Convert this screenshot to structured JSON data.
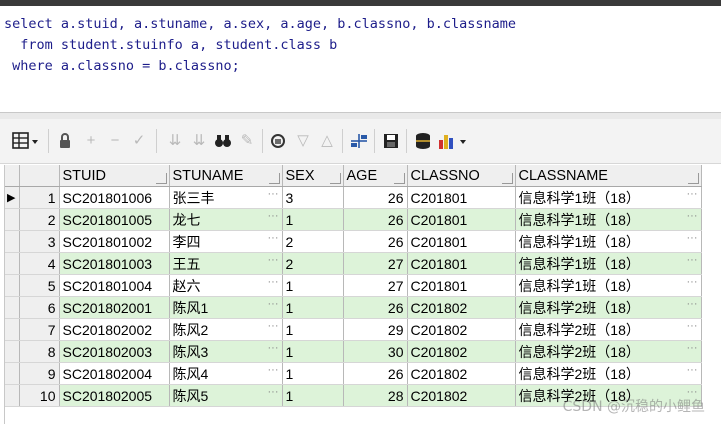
{
  "sql": {
    "line1": "select a.stuid, a.stuname, a.sex, a.age, b.classno, b.classname",
    "line2": "  from student.stuinfo a, student.class b",
    "line3": " where a.classno = b.classno;"
  },
  "toolbar": {
    "icons": [
      "grid-icon",
      "lock-icon",
      "plus-icon",
      "minus-icon",
      "check-icon",
      "filter-down-icon",
      "filter-up-icon",
      "binoculars-icon",
      "clear-icon",
      "query-icon",
      "down-icon",
      "up-icon",
      "link-icon",
      "save-icon",
      "database-icon",
      "chart-icon"
    ]
  },
  "grid": {
    "columns": [
      "STUID",
      "STUNAME",
      "SEX",
      "AGE",
      "CLASSNO",
      "CLASSNAME"
    ],
    "rows": [
      {
        "n": "1",
        "stuid": "SC201801006",
        "stuname": "张三丰",
        "sex": "3",
        "age": "26",
        "classno": "C201801",
        "classname": "信息科学1班（18）"
      },
      {
        "n": "2",
        "stuid": "SC201801005",
        "stuname": "龙七",
        "sex": "1",
        "age": "26",
        "classno": "C201801",
        "classname": "信息科学1班（18）"
      },
      {
        "n": "3",
        "stuid": "SC201801002",
        "stuname": "李四",
        "sex": "2",
        "age": "26",
        "classno": "C201801",
        "classname": "信息科学1班（18）"
      },
      {
        "n": "4",
        "stuid": "SC201801003",
        "stuname": "王五",
        "sex": "2",
        "age": "27",
        "classno": "C201801",
        "classname": "信息科学1班（18）"
      },
      {
        "n": "5",
        "stuid": "SC201801004",
        "stuname": "赵六",
        "sex": "1",
        "age": "27",
        "classno": "C201801",
        "classname": "信息科学1班（18）"
      },
      {
        "n": "6",
        "stuid": "SC201802001",
        "stuname": "陈风1",
        "sex": "1",
        "age": "26",
        "classno": "C201802",
        "classname": "信息科学2班（18）"
      },
      {
        "n": "7",
        "stuid": "SC201802002",
        "stuname": "陈风2",
        "sex": "1",
        "age": "29",
        "classno": "C201802",
        "classname": "信息科学2班（18）"
      },
      {
        "n": "8",
        "stuid": "SC201802003",
        "stuname": "陈风3",
        "sex": "1",
        "age": "30",
        "classno": "C201802",
        "classname": "信息科学2班（18）"
      },
      {
        "n": "9",
        "stuid": "SC201802004",
        "stuname": "陈风4",
        "sex": "1",
        "age": "26",
        "classno": "C201802",
        "classname": "信息科学2班（18）"
      },
      {
        "n": "10",
        "stuid": "SC201802005",
        "stuname": "陈风5",
        "sex": "1",
        "age": "28",
        "classno": "C201802",
        "classname": "信息科学2班（18）"
      }
    ]
  },
  "watermark": "CSDN @沉稳的小鲤鱼"
}
